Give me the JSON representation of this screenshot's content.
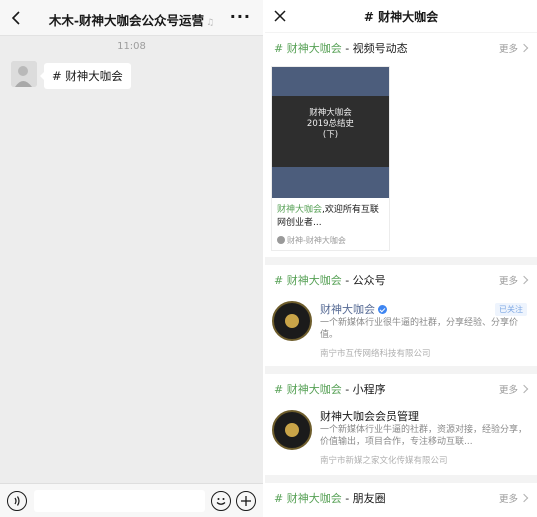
{
  "chat": {
    "title": "木木-财神大咖会公众号运营",
    "timestamp": "11:08",
    "message": "# 财神大咖会",
    "input_value": ""
  },
  "topic": {
    "title": "# 财神大咖会",
    "tag": "# 财神大咖会",
    "more_label": "更多",
    "sections": {
      "channels": {
        "suffix": " - 视频号动态",
        "video": {
          "thumb_lines": [
            "财神大咖会",
            "2019总结史",
            "(下)"
          ],
          "desc_tag": "财神大咖会",
          "desc_text": ",欢迎所有互联网创业者...",
          "author": "财神-财神大咖会"
        }
      },
      "official": {
        "suffix": " - 公众号",
        "name": "财神大咖会",
        "status": "已关注",
        "desc": "一个新媒体行业很牛逼的社群，分享经验、分享价值。",
        "company": "南宁市互传网络科技有限公司"
      },
      "miniprogram": {
        "suffix": " - 小程序",
        "name": "财神大咖会会员管理",
        "desc": "一个新媒体行业牛逼的社群，资源对接，经验分享，价值输出，项目合作，专注移动互联...",
        "company": "南宁市新媒之家文化传媒有限公司"
      },
      "moments": {
        "suffix": " - 朋友圈"
      }
    }
  },
  "colors": {
    "accent_green": "#57a156",
    "link_blue": "#576b95",
    "verified_blue": "#3f86f2"
  }
}
